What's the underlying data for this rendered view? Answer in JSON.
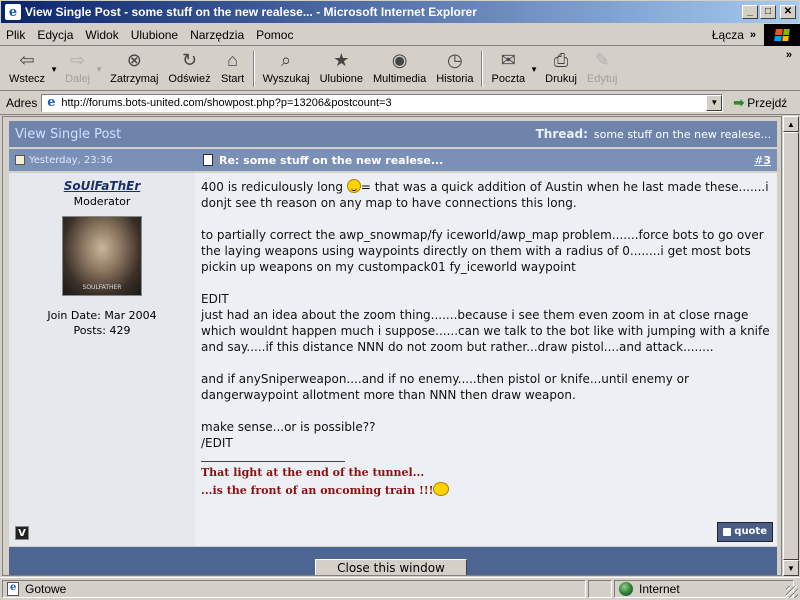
{
  "window": {
    "title": "View Single Post - some stuff on the new realese... - Microsoft Internet Explorer",
    "min_glyph": "_",
    "max_glyph": "□",
    "close_glyph": "✕"
  },
  "menu": {
    "items": [
      "Plik",
      "Edycja",
      "Widok",
      "Ulubione",
      "Narzędzia",
      "Pomoc"
    ],
    "links_label": "Łącza",
    "chevron": "»"
  },
  "toolbar": {
    "back": "Wstecz",
    "forward": "Dalej",
    "stop": "Zatrzymaj",
    "refresh": "Odśwież",
    "home": "Start",
    "search": "Wyszukaj",
    "favorites": "Ulubione",
    "media": "Multimedia",
    "history": "Historia",
    "mail": "Poczta",
    "print": "Drukuj",
    "edit": "Edytuj",
    "chevron": "»"
  },
  "address": {
    "label": "Adres",
    "url": "http://forums.bots-united.com/showpost.php?p=13206&postcount=3",
    "go_label": "Przejdź"
  },
  "page": {
    "header_title": "View Single Post",
    "thread_label": "Thread:",
    "thread_title": "some stuff on the new realese...",
    "post_date": "Yesterday, 23:36",
    "post_title": "Re: some stuff on the new realese...",
    "post_number_hash": "#",
    "post_number": "3",
    "username": "SoUlFaThEr",
    "user_title": "Moderator",
    "avatar_label": "SOULFATHER",
    "join_date": "Join Date: Mar 2004",
    "posts": "Posts: 429",
    "v_badge": "V",
    "msg_line1_a": "400 is rediculously long ",
    "msg_line1_b": "= that was a quick addition of Austin when he last made these.......i donjt see th reason on any map to have connections this long.",
    "msg_para2": "to partially correct the awp_snowmap/fy iceworld/awp_map problem.......force bots to go over the laying weapons using waypoints directly on them with a radius of 0........i get most bots pickin up weapons on my custompack01 fy_iceworld waypoint",
    "msg_edit_open": "EDIT",
    "msg_para3": "just had an idea about the zoom thing.......because i see them even zoom in at close rnage which wouldnt happen much i suppose......can we talk to the bot like with jumping with a knife and say.....if this distance NNN do not zoom but rather...draw pistol....and attack........",
    "msg_para4": "and if anySniperweapon....and if no enemy.....then pistol or knife...until enemy or dangerwaypoint allotment more than NNN then draw weapon.",
    "msg_para5": "make sense...or is possible??",
    "msg_edit_close": "/EDIT",
    "sig_line1": "That light at the end of the tunnel...",
    "sig_line2": "...is the front of an oncoming train !!!",
    "quote_label": "quote",
    "close_window": "Close this window"
  },
  "status": {
    "text": "Gotowe",
    "zone": "Internet"
  }
}
